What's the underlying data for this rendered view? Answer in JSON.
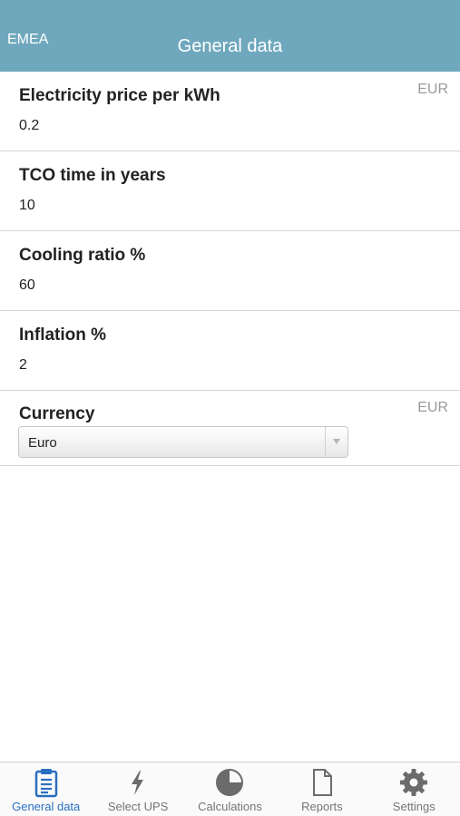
{
  "header": {
    "left_label": "EMEA",
    "title": "General data"
  },
  "fields": [
    {
      "label": "Electricity price per kWh",
      "value": "0.2",
      "unit": "EUR"
    },
    {
      "label": "TCO time in years",
      "value": "10"
    },
    {
      "label": "Cooling ratio %",
      "value": "60"
    },
    {
      "label": "Inflation %",
      "value": "2"
    }
  ],
  "currency": {
    "label": "Currency",
    "unit": "EUR",
    "selected": "Euro"
  },
  "tabs": [
    {
      "label": "General data",
      "icon": "clipboard-icon",
      "active": true
    },
    {
      "label": "Select UPS",
      "icon": "lightning-icon",
      "active": false
    },
    {
      "label": "Calculations",
      "icon": "pie-chart-icon",
      "active": false
    },
    {
      "label": "Reports",
      "icon": "document-icon",
      "active": false
    },
    {
      "label": "Settings",
      "icon": "gear-icon",
      "active": false
    }
  ],
  "colors": {
    "header_bg": "#6fa8bd",
    "active_tab": "#2a6fc0",
    "inactive_tab": "#757575"
  }
}
